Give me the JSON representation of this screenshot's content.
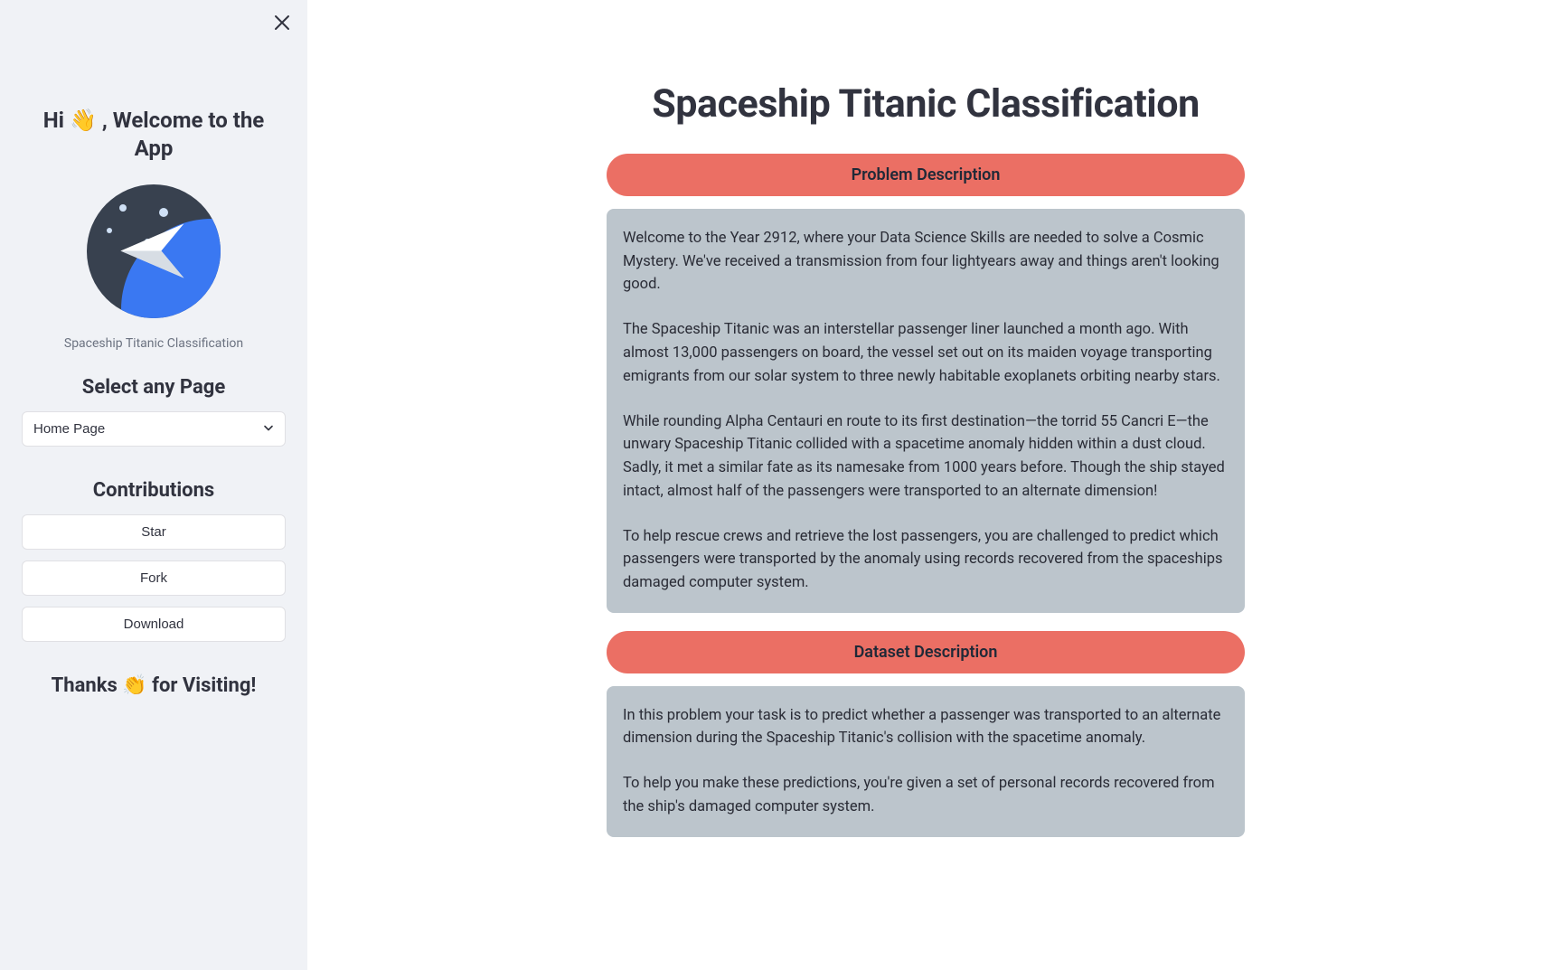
{
  "sidebar": {
    "greeting": "Hi 👋 , Welcome to the App",
    "logo_caption": "Spaceship Titanic Classification",
    "select_heading": "Select any Page",
    "page_select_value": "Home Page",
    "contributions_heading": "Contributions",
    "buttons": {
      "star": "Star",
      "fork": "Fork",
      "download": "Download"
    },
    "thanks": "Thanks 👏 for Visiting!"
  },
  "main": {
    "title": "Spaceship Titanic Classification",
    "sections": [
      {
        "heading": "Problem Description",
        "paragraphs": [
          "Welcome to the Year 2912, where your Data Science Skills are needed to solve a Cosmic Mystery. We've received a transmission from four lightyears away and things aren't looking good.",
          "The Spaceship Titanic was an interstellar passenger liner launched a month ago. With almost 13,000 passengers on board, the vessel set out on its maiden voyage transporting emigrants from our solar system to three newly habitable exoplanets orbiting nearby stars.",
          "While rounding Alpha Centauri en route to its first destination—the torrid 55 Cancri E—the unwary Spaceship Titanic collided with a spacetime anomaly hidden within a dust cloud. Sadly, it met a similar fate as its namesake from 1000 years before. Though the ship stayed intact, almost half of the passengers were transported to an alternate dimension!",
          "To help rescue crews and retrieve the lost passengers, you are challenged to predict which passengers were transported by the anomaly using records recovered from the spaceships damaged computer system."
        ]
      },
      {
        "heading": "Dataset Description",
        "paragraphs": [
          "In this problem your task is to predict whether a passenger was transported to an alternate dimension during the Spaceship Titanic's collision with the spacetime anomaly.",
          "To help you make these predictions, you're given a set of personal records recovered from the ship's damaged computer system."
        ]
      }
    ]
  }
}
